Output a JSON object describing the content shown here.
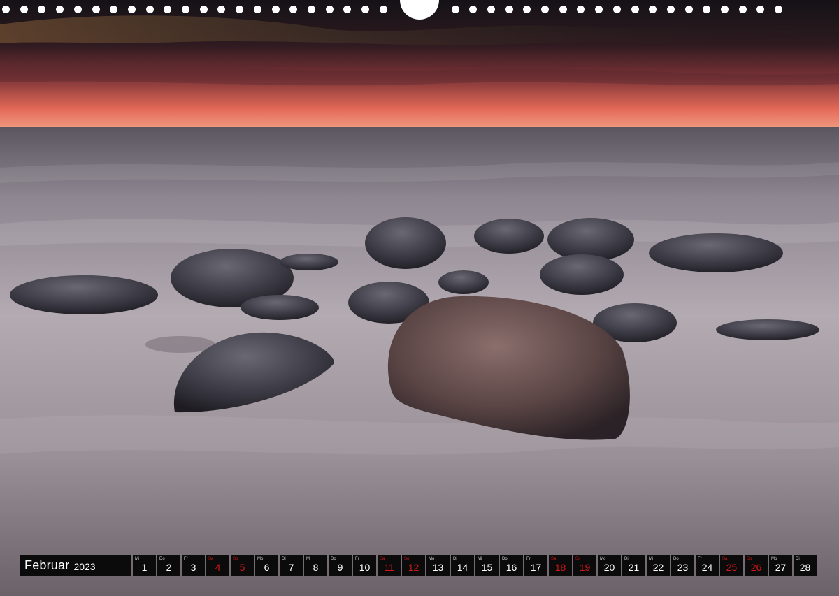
{
  "calendar": {
    "month": "Februar",
    "year": "2023",
    "weekend_color": "#d01818",
    "days": [
      {
        "wd": "Mi",
        "num": "1",
        "weekend": false
      },
      {
        "wd": "Do",
        "num": "2",
        "weekend": false
      },
      {
        "wd": "Fr",
        "num": "3",
        "weekend": false
      },
      {
        "wd": "Sa",
        "num": "4",
        "weekend": true
      },
      {
        "wd": "So",
        "num": "5",
        "weekend": true
      },
      {
        "wd": "Mo",
        "num": "6",
        "weekend": false
      },
      {
        "wd": "Di",
        "num": "7",
        "weekend": false
      },
      {
        "wd": "Mi",
        "num": "8",
        "weekend": false
      },
      {
        "wd": "Do",
        "num": "9",
        "weekend": false
      },
      {
        "wd": "Fr",
        "num": "10",
        "weekend": false
      },
      {
        "wd": "Sa",
        "num": "11",
        "weekend": true
      },
      {
        "wd": "So",
        "num": "12",
        "weekend": true
      },
      {
        "wd": "Mo",
        "num": "13",
        "weekend": false
      },
      {
        "wd": "Di",
        "num": "14",
        "weekend": false
      },
      {
        "wd": "Mi",
        "num": "15",
        "weekend": false
      },
      {
        "wd": "Do",
        "num": "16",
        "weekend": false
      },
      {
        "wd": "Fr",
        "num": "17",
        "weekend": false
      },
      {
        "wd": "Sa",
        "num": "18",
        "weekend": true
      },
      {
        "wd": "So",
        "num": "19",
        "weekend": true
      },
      {
        "wd": "Mo",
        "num": "20",
        "weekend": false
      },
      {
        "wd": "Di",
        "num": "21",
        "weekend": false
      },
      {
        "wd": "Mi",
        "num": "22",
        "weekend": false
      },
      {
        "wd": "Do",
        "num": "23",
        "weekend": false
      },
      {
        "wd": "Fr",
        "num": "24",
        "weekend": false
      },
      {
        "wd": "Sa",
        "num": "25",
        "weekend": true
      },
      {
        "wd": "So",
        "num": "26",
        "weekend": true
      },
      {
        "wd": "Mo",
        "num": "27",
        "weekend": false
      },
      {
        "wd": "Di",
        "num": "28",
        "weekend": false
      }
    ]
  },
  "photo": {
    "sky_colors": [
      "#1c1418",
      "#3a1e26",
      "#8a3a38",
      "#e8705c",
      "#f2967a"
    ],
    "sea_colors": [
      "#6e6670",
      "#9a9098",
      "#b7aeb4",
      "#8d848c",
      "#5e565e"
    ],
    "rock_color": "#3a3840"
  }
}
